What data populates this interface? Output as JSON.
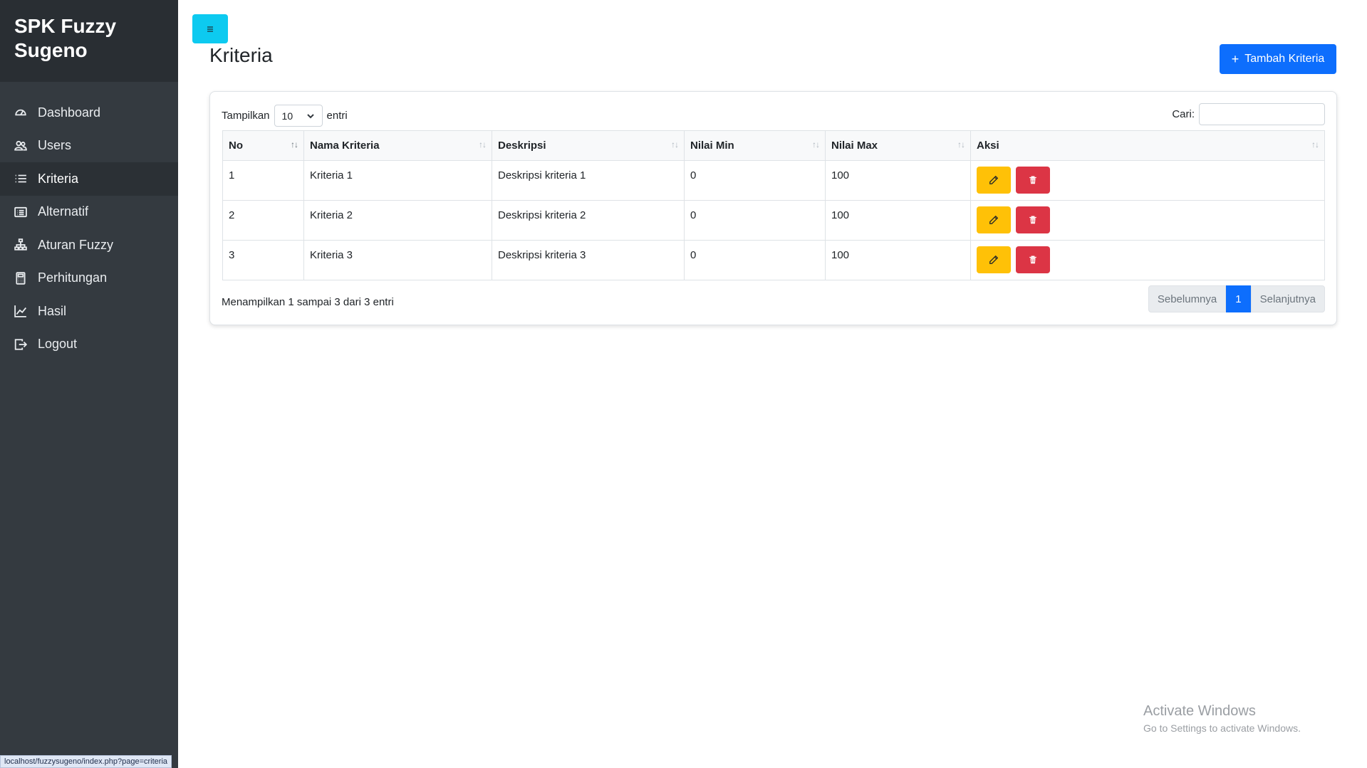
{
  "sidebar": {
    "brand": "SPK Fuzzy Sugeno",
    "items": [
      {
        "label": "Dashboard",
        "icon": "speedometer-icon"
      },
      {
        "label": "Users",
        "icon": "people-icon"
      },
      {
        "label": "Kriteria",
        "icon": "list-icon"
      },
      {
        "label": "Alternatif",
        "icon": "card-list-icon"
      },
      {
        "label": "Aturan Fuzzy",
        "icon": "diagram-icon"
      },
      {
        "label": "Perhitungan",
        "icon": "calculator-icon"
      },
      {
        "label": "Hasil",
        "icon": "graph-up-icon"
      },
      {
        "label": "Logout",
        "icon": "box-arrow-right-icon"
      }
    ],
    "active_item": "Kriteria"
  },
  "header": {
    "toggle_icon": "hamburger-icon",
    "title": "Kriteria",
    "add_button_label": "Tambah Kriteria"
  },
  "datatable": {
    "length_label_before": "Tampilkan",
    "length_value": "10",
    "length_label_after": "entri",
    "search_label": "Cari:",
    "search_value": "",
    "columns": [
      "No",
      "Nama Kriteria",
      "Deskripsi",
      "Nilai Min",
      "Nilai Max",
      "Aksi"
    ],
    "rows": [
      {
        "no": "1",
        "nama": "Kriteria 1",
        "deskripsi": "Deskripsi kriteria 1",
        "min": "0",
        "max": "100"
      },
      {
        "no": "2",
        "nama": "Kriteria 2",
        "deskripsi": "Deskripsi kriteria 2",
        "min": "0",
        "max": "100"
      },
      {
        "no": "3",
        "nama": "Kriteria 3",
        "deskripsi": "Deskripsi kriteria 3",
        "min": "0",
        "max": "100"
      }
    ],
    "info": "Menampilkan 1 sampai 3 dari 3 entri",
    "pager": {
      "prev": "Sebelumnya",
      "current": "1",
      "next": "Selanjutnya"
    }
  },
  "colors": {
    "sidebar_bg": "#343a40",
    "primary": "#0d6efd",
    "info": "#0dcaf0",
    "warning": "#ffc107",
    "danger": "#dc3545"
  },
  "watermark": {
    "title": "Activate Windows",
    "subtitle": "Go to Settings to activate Windows."
  },
  "statusbar": {
    "url": "localhost/fuzzysugeno/index.php?page=criteria"
  }
}
